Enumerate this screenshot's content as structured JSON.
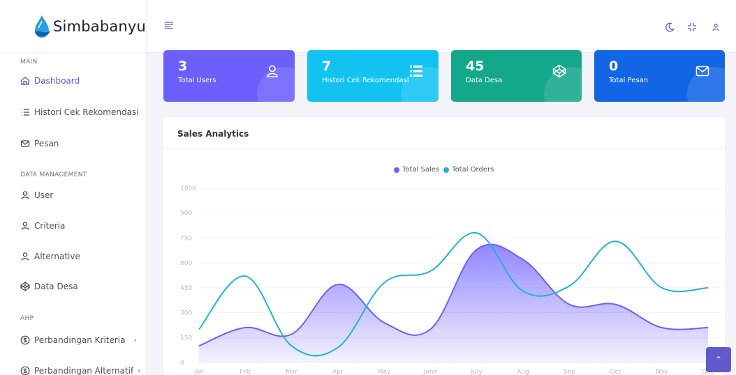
{
  "brand": {
    "name": "Simbabanyu"
  },
  "sidebar": {
    "sections": [
      {
        "title": "MAIN"
      },
      {
        "title": "DATA MANAGEMENT"
      },
      {
        "title": "AHP"
      }
    ],
    "items": [
      {
        "label": "Dashboard",
        "icon": "home-icon"
      },
      {
        "label": "Histori Cek Rekomendasi",
        "icon": "list-icon"
      },
      {
        "label": "Pesan",
        "icon": "mail-icon"
      },
      {
        "label": "User",
        "icon": "user-icon"
      },
      {
        "label": "Criteria",
        "icon": "user-icon"
      },
      {
        "label": "Alternative",
        "icon": "user-icon"
      },
      {
        "label": "Data Desa",
        "icon": "codepen-icon"
      },
      {
        "label": "Perbandingan Kriteria",
        "icon": "dollar-circle-icon"
      },
      {
        "label": "Perbandingan Alternatif",
        "icon": "dollar-circle-icon"
      }
    ]
  },
  "cards": [
    {
      "value": "3",
      "label": "Total Users",
      "icon": "user-icon",
      "color": "#6c5ffc"
    },
    {
      "value": "7",
      "label": "Histori Cek Rekomendasi",
      "icon": "list-icon",
      "color": "#12c3f2"
    },
    {
      "value": "45",
      "label": "Data Desa",
      "icon": "codepen-icon",
      "color": "#13a88a"
    },
    {
      "value": "0",
      "label": "Total Pesan",
      "icon": "mail-icon",
      "color": "#1266e6"
    }
  ],
  "panel": {
    "title": "Sales Analytics"
  },
  "chart_data": {
    "type": "area",
    "categories": [
      "Jan",
      "Feb",
      "Mar",
      "Apr",
      "May",
      "June",
      "July",
      "Aug",
      "Sep",
      "Oct",
      "Nov",
      "Dec"
    ],
    "series": [
      {
        "name": "Total Sales",
        "values": [
          100,
          210,
          170,
          470,
          240,
          200,
          680,
          620,
          350,
          350,
          210,
          210
        ],
        "color": "#6c5ffc"
      },
      {
        "name": "Total Orders",
        "values": [
          200,
          520,
          100,
          90,
          480,
          550,
          780,
          430,
          460,
          730,
          450,
          450
        ],
        "color": "#20b2d8"
      }
    ],
    "yticks": [
      "0",
      "150",
      "300",
      "450",
      "600",
      "750",
      "900",
      "1050"
    ],
    "ylim": [
      0,
      1050
    ],
    "legend": "top-center",
    "grid": true
  }
}
